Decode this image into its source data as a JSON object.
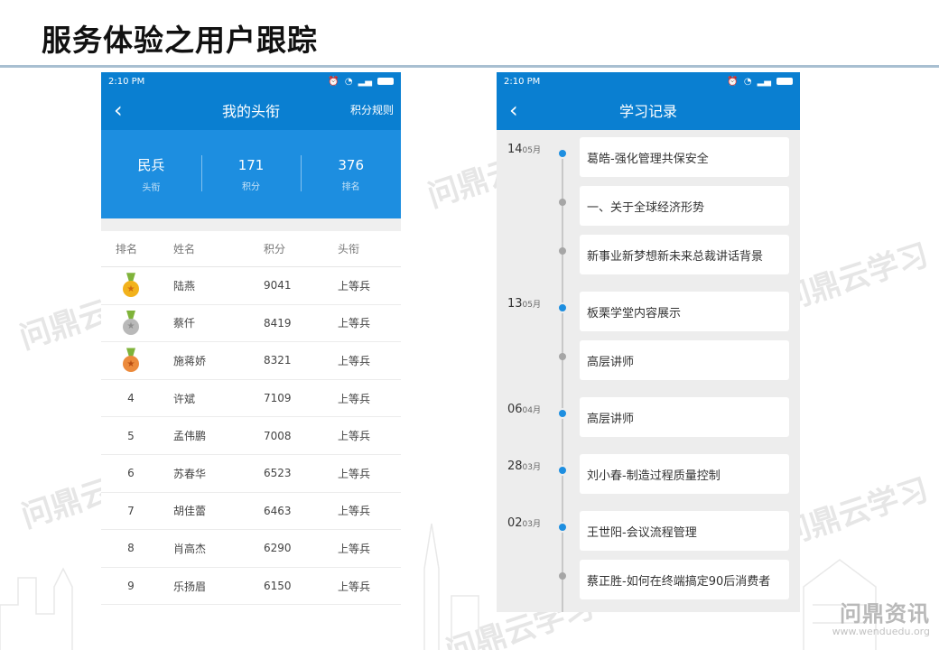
{
  "slide": {
    "title": "服务体验之用户跟踪"
  },
  "watermark": {
    "text": "问鼎云学习"
  },
  "brand": {
    "logo": "问鼎资讯",
    "url": "www.wenduedu.org"
  },
  "left_phone": {
    "status": {
      "time": "2:10 PM"
    },
    "nav": {
      "back_icon": "chevron-left-icon",
      "title": "我的头衔",
      "action": "积分规则"
    },
    "stats": [
      {
        "value": "民兵",
        "label": "头衔"
      },
      {
        "value": "171",
        "label": "积分"
      },
      {
        "value": "376",
        "label": "排名"
      }
    ],
    "table": {
      "headers": [
        "排名",
        "姓名",
        "积分",
        "头衔"
      ],
      "rows": [
        {
          "rank": "",
          "medal": "gold",
          "name": "陆燕",
          "score": "9041",
          "title": "上等兵"
        },
        {
          "rank": "",
          "medal": "silver",
          "name": "蔡仟",
          "score": "8419",
          "title": "上等兵"
        },
        {
          "rank": "",
          "medal": "bronze",
          "name": "施蒋娇",
          "score": "8321",
          "title": "上等兵"
        },
        {
          "rank": "4",
          "name": "许斌",
          "score": "7109",
          "title": "上等兵"
        },
        {
          "rank": "5",
          "name": "孟伟鹏",
          "score": "7008",
          "title": "上等兵"
        },
        {
          "rank": "6",
          "name": "苏春华",
          "score": "6523",
          "title": "上等兵"
        },
        {
          "rank": "7",
          "name": "胡佳蕾",
          "score": "6463",
          "title": "上等兵"
        },
        {
          "rank": "8",
          "name": "肖高杰",
          "score": "6290",
          "title": "上等兵"
        },
        {
          "rank": "9",
          "name": "乐扬眉",
          "score": "6150",
          "title": "上等兵"
        }
      ]
    }
  },
  "right_phone": {
    "status": {
      "time": "2:10 PM"
    },
    "nav": {
      "back_icon": "chevron-left-icon",
      "title": "学习记录"
    },
    "timeline": [
      {
        "day": "14",
        "month": "05月",
        "title": "葛皓-强化管理共保安全"
      },
      {
        "day": "",
        "month": "",
        "title": "一、关于全球经济形势"
      },
      {
        "day": "",
        "month": "",
        "title": "新事业新梦想新未来总裁讲话背景"
      },
      {
        "day": "13",
        "month": "05月",
        "title": "板栗学堂内容展示"
      },
      {
        "day": "",
        "month": "",
        "title": "高层讲师"
      },
      {
        "day": "06",
        "month": "04月",
        "title": "高层讲师"
      },
      {
        "day": "28",
        "month": "03月",
        "title": "刘小春-制造过程质量控制"
      },
      {
        "day": "02",
        "month": "03月",
        "title": "王世阳-会议流程管理"
      },
      {
        "day": "",
        "month": "",
        "title": "蔡正胜-如何在终端搞定90后消费者"
      }
    ]
  }
}
